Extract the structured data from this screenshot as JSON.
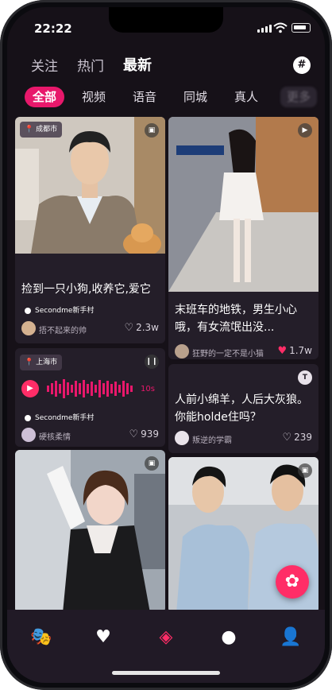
{
  "status_bar": {
    "time": "22:22"
  },
  "header": {
    "tabs": [
      {
        "label": "关注"
      },
      {
        "label": "热门"
      },
      {
        "label": "最新"
      }
    ],
    "hash_icon": "#"
  },
  "categories": [
    {
      "label": "全部"
    },
    {
      "label": "视频"
    },
    {
      "label": "语音"
    },
    {
      "label": "同城"
    },
    {
      "label": "真人"
    },
    {
      "label": "更多"
    }
  ],
  "feed": {
    "card1": {
      "location": "成都市",
      "title": "捡到一只小狗,收养它,爱它",
      "game": "Secondme新手村",
      "user": "捂不起来的帅",
      "likes": "2.3w"
    },
    "card2": {
      "title": "末班车的地铁，男生小心哦，有女流氓出没...",
      "user": "狂野的一定不是小猫",
      "likes": "1.7w"
    },
    "card3": {
      "location": "上海市",
      "duration": "10s",
      "game": "Secondme新手村",
      "user": "硬核柔情",
      "likes": "939"
    },
    "card4": {
      "title": "人前小绵羊，人后大灰狼。你能holde住吗？",
      "user": "叛逆的学霸",
      "likes": "239",
      "badge": "T"
    }
  },
  "colors": {
    "accent": "#e8186b",
    "background": "#161118",
    "card": "#241e29"
  },
  "icons": [
    "mask-icon",
    "heart-hands-icon",
    "compass-icon",
    "chat-bubble-icon",
    "profile-icon",
    "pinwheel-icon"
  ]
}
